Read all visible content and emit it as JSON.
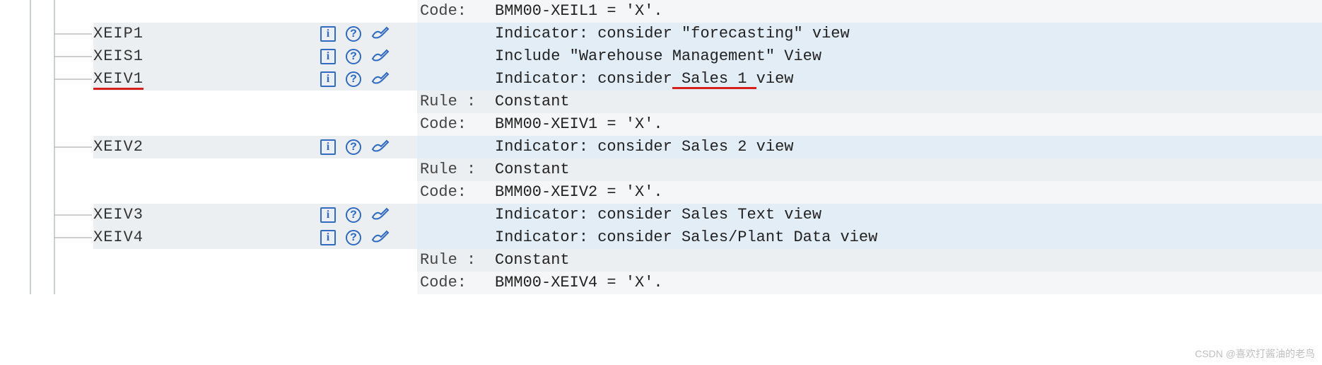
{
  "labels": {
    "rule": "Rule :",
    "code": "Code:"
  },
  "icons": {
    "info": "i",
    "help": "?",
    "edit": "edit-pen"
  },
  "tree": {
    "n0": "XEIP1",
    "n1": "XEIS1",
    "n2": "XEIV1",
    "n3": "XEIV2",
    "n4": "XEIV3",
    "n5": "XEIV4"
  },
  "rows": {
    "r0": {
      "code": "BMM00-XEIL1 = 'X'."
    },
    "r1": {
      "desc": "Indicator: consider \"forecasting\" view"
    },
    "r2": {
      "desc": "Include \"Warehouse Management\" View"
    },
    "r3": {
      "desc_a": "Indicator: consider",
      "desc_b": " Sales 1 ",
      "desc_c": "view"
    },
    "r4": {
      "rule": "Constant"
    },
    "r5": {
      "code": "BMM00-XEIV1 = 'X'."
    },
    "r6": {
      "desc": "Indicator: consider Sales 2 view"
    },
    "r7": {
      "rule": "Constant"
    },
    "r8": {
      "code": "BMM00-XEIV2 = 'X'."
    },
    "r9": {
      "desc": "Indicator: consider Sales Text view"
    },
    "r10": {
      "desc": "Indicator: consider Sales/Plant Data view"
    },
    "r11": {
      "rule": "Constant"
    },
    "r12": {
      "code": "BMM00-XEIV4 = 'X'."
    }
  },
  "watermark": "CSDN @喜欢打酱油的老鸟"
}
